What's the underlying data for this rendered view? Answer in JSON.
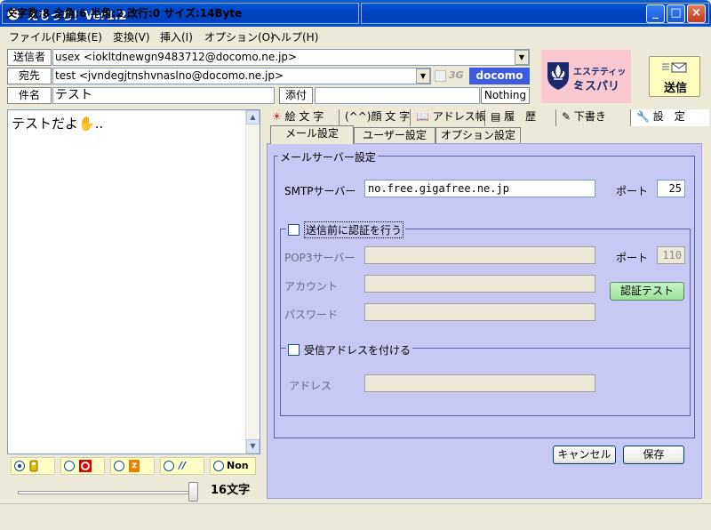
{
  "window": {
    "title": "えもっち！Ver1.2",
    "minimize_glyph": "_",
    "maximize_glyph": "□",
    "close_glyph": "×"
  },
  "menu": [
    {
      "label": "ファイル(F)"
    },
    {
      "label": "編集(E)"
    },
    {
      "label": "変換(V)"
    },
    {
      "label": "挿入(I)"
    },
    {
      "label": "オプション(O)"
    },
    {
      "label": "ヘルプ(H)"
    }
  ],
  "header": {
    "from_label": "送信者",
    "from_value": "usex <iokltdnewgn9483712@docomo.ne.jp>",
    "to_label": "宛先",
    "to_value": "test <jvndegjtnshvnaslno@docomo.ne.jp>",
    "three_g_label": "3G",
    "carrier_badge": "docomo",
    "subject_label": "件名",
    "subject_value": "テスト",
    "attach_label": "添付",
    "attach_value": "",
    "attach_status": "Nothing",
    "ad_line1": "エステティック",
    "ad_line2": "ミスパリ",
    "send_label": "送信"
  },
  "editor": {
    "text": "テストだよ",
    "emoji": "✋",
    "trailing": ".."
  },
  "carriers": [
    {
      "name": "docomo",
      "selected": true,
      "label": ""
    },
    {
      "name": "au",
      "selected": false,
      "label": ""
    },
    {
      "name": "softbank",
      "selected": false,
      "label": "z"
    },
    {
      "name": "willcom",
      "selected": false,
      "label": "//"
    },
    {
      "name": "none",
      "selected": false,
      "label": "Non"
    }
  ],
  "char_count": "16文字",
  "status": {
    "text": "文字数:8 全角:6 半角:2 改行:0 サイズ:14Byte"
  },
  "tabs_top": [
    {
      "label": "絵 文 字"
    },
    {
      "label": "(^^)顔 文 字"
    },
    {
      "label": "アドレス帳"
    },
    {
      "label": "履　歴"
    },
    {
      "label": "下書き"
    },
    {
      "label": "設　定"
    }
  ],
  "tabs_sub": [
    {
      "label": "メール設定"
    },
    {
      "label": "ユーザー設定"
    },
    {
      "label": "オプション設定"
    }
  ],
  "mail_server": {
    "group_title": "メールサーバー設定",
    "smtp_label": "SMTPサーバー",
    "smtp_value": "no.free.gigafree.ne.jp",
    "port_label": "ポート",
    "smtp_port": "25",
    "auth_label": "送信前に認証を行う",
    "pop3_label": "POP3サーバー",
    "pop3_value": "",
    "pop3_port_label": "ポート",
    "pop3_port": "110",
    "account_label": "アカウント",
    "account_value": "",
    "password_label": "パスワード",
    "password_value": "",
    "auth_test_label": "認証テスト",
    "reply_group_title": "受信アドレスを付ける",
    "address_label": "アドレス",
    "address_value": ""
  },
  "buttons": {
    "cancel": "キャンセル",
    "save": "保存"
  }
}
